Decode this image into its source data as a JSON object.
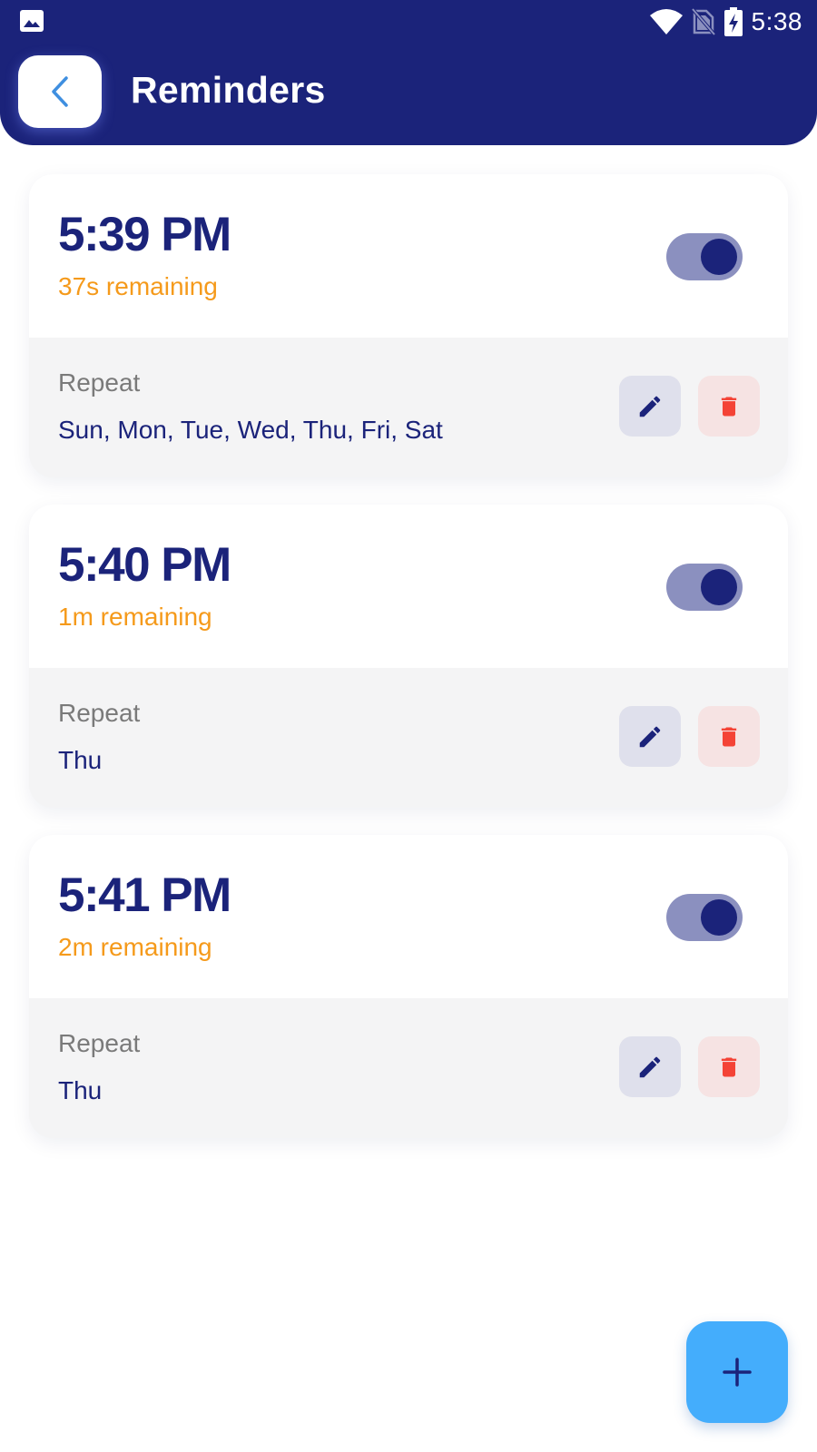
{
  "status_bar": {
    "time": "5:38",
    "icons": [
      "gallery-icon",
      "wifi-icon",
      "no-sim-icon",
      "battery-charging-icon"
    ]
  },
  "header": {
    "title": "Reminders",
    "back_icon": "chevron-left-icon"
  },
  "reminders": [
    {
      "time": "5:39 PM",
      "remaining": "37s remaining",
      "enabled": true,
      "repeat_label": "Repeat",
      "repeat_days": "Sun, Mon, Tue, Wed, Thu, Fri, Sat"
    },
    {
      "time": "5:40 PM",
      "remaining": "1m remaining",
      "enabled": true,
      "repeat_label": "Repeat",
      "repeat_days": "Thu"
    },
    {
      "time": "5:41 PM",
      "remaining": "2m remaining",
      "enabled": true,
      "repeat_label": "Repeat",
      "repeat_days": "Thu"
    }
  ],
  "fab_icon": "plus-icon",
  "colors": {
    "primary": "#1b237a",
    "accent_orange": "#f59a1b",
    "fab_blue": "#44adfc",
    "delete_red": "#f44336",
    "toggle_track": "#8b90bf"
  }
}
